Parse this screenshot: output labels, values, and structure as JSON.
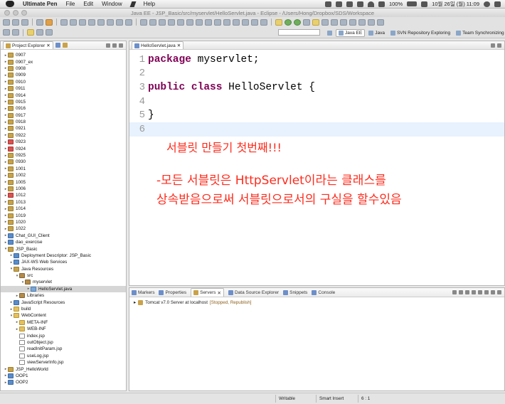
{
  "menubar": {
    "app_name": "Ultimate Pen",
    "menus": [
      "File",
      "Edit",
      "Window",
      "Help"
    ],
    "battery": "100%",
    "clock": "10월 26일 (월) 11:09"
  },
  "window": {
    "title": "Java EE - JSP_Basic/src/myservlet/HelloServlet.java - Eclipse - /Users/Hong/Dropbox/SDS/Workspace"
  },
  "perspectives": [
    {
      "label": "Java EE",
      "active": true
    },
    {
      "label": "Java",
      "active": false
    },
    {
      "label": "SVN Repository Exploring",
      "active": false
    },
    {
      "label": "Team Synchronizing",
      "active": false
    }
  ],
  "explorer": {
    "tab_label": "Project Explorer",
    "tree": [
      {
        "label": "0907",
        "depth": 0,
        "icon": "project-folder-icon",
        "expand": "collapsed"
      },
      {
        "label": "0907_ex",
        "depth": 0,
        "icon": "project-folder-icon",
        "expand": "collapsed"
      },
      {
        "label": "0908",
        "depth": 0,
        "icon": "project-folder-icon",
        "expand": "collapsed"
      },
      {
        "label": "0909",
        "depth": 0,
        "icon": "project-folder-icon",
        "expand": "collapsed"
      },
      {
        "label": "0910",
        "depth": 0,
        "icon": "project-folder-icon",
        "expand": "collapsed"
      },
      {
        "label": "0911",
        "depth": 0,
        "icon": "project-folder-icon",
        "expand": "collapsed"
      },
      {
        "label": "0914",
        "depth": 0,
        "icon": "project-folder-icon",
        "expand": "collapsed"
      },
      {
        "label": "0915",
        "depth": 0,
        "icon": "project-folder-icon",
        "expand": "collapsed"
      },
      {
        "label": "0916",
        "depth": 0,
        "icon": "project-folder-icon",
        "expand": "collapsed"
      },
      {
        "label": "0917",
        "depth": 0,
        "icon": "project-folder-icon",
        "expand": "collapsed"
      },
      {
        "label": "0918",
        "depth": 0,
        "icon": "project-folder-icon",
        "expand": "collapsed"
      },
      {
        "label": "0921",
        "depth": 0,
        "icon": "project-folder-icon",
        "expand": "collapsed"
      },
      {
        "label": "0922",
        "depth": 0,
        "icon": "project-folder-icon",
        "expand": "collapsed"
      },
      {
        "label": "0923",
        "depth": 0,
        "icon": "project-error-icon",
        "expand": "collapsed"
      },
      {
        "label": "0924",
        "depth": 0,
        "icon": "project-error-icon",
        "expand": "collapsed"
      },
      {
        "label": "0925",
        "depth": 0,
        "icon": "project-folder-icon",
        "expand": "collapsed"
      },
      {
        "label": "0930",
        "depth": 0,
        "icon": "project-folder-icon",
        "expand": "collapsed"
      },
      {
        "label": "1001",
        "depth": 0,
        "icon": "project-folder-icon",
        "expand": "collapsed"
      },
      {
        "label": "1002",
        "depth": 0,
        "icon": "project-folder-icon",
        "expand": "collapsed"
      },
      {
        "label": "1005",
        "depth": 0,
        "icon": "project-folder-icon",
        "expand": "collapsed"
      },
      {
        "label": "1006",
        "depth": 0,
        "icon": "project-folder-icon",
        "expand": "collapsed"
      },
      {
        "label": "1012",
        "depth": 0,
        "icon": "project-error-icon",
        "expand": "collapsed"
      },
      {
        "label": "1013",
        "depth": 0,
        "icon": "project-folder-icon",
        "expand": "collapsed"
      },
      {
        "label": "1014",
        "depth": 0,
        "icon": "project-folder-icon",
        "expand": "collapsed"
      },
      {
        "label": "1019",
        "depth": 0,
        "icon": "project-folder-icon",
        "expand": "collapsed"
      },
      {
        "label": "1020",
        "depth": 0,
        "icon": "project-folder-icon",
        "expand": "collapsed"
      },
      {
        "label": "1022",
        "depth": 0,
        "icon": "project-folder-icon",
        "expand": "collapsed"
      },
      {
        "label": "Chat_GUI_Client",
        "depth": 0,
        "icon": "java-project-icon",
        "expand": "collapsed"
      },
      {
        "label": "dao_exercise",
        "depth": 0,
        "icon": "java-project-icon",
        "expand": "collapsed"
      },
      {
        "label": "JSP_Basic",
        "depth": 0,
        "icon": "project-folder-icon",
        "expand": "expanded"
      },
      {
        "label": "Deployment Descriptor: JSP_Basic",
        "depth": 1,
        "icon": "descriptor-icon",
        "expand": "collapsed"
      },
      {
        "label": "JAX-WS Web Services",
        "depth": 1,
        "icon": "webservice-icon",
        "expand": "collapsed"
      },
      {
        "label": "Java Resources",
        "depth": 1,
        "icon": "resources-icon",
        "expand": "expanded"
      },
      {
        "label": "src",
        "depth": 2,
        "icon": "source-folder-icon",
        "expand": "expanded"
      },
      {
        "label": "myservlet",
        "depth": 3,
        "icon": "package-icon",
        "expand": "expanded"
      },
      {
        "label": "HelloServlet.java",
        "depth": 4,
        "icon": "java-file-icon",
        "expand": "collapsed",
        "selected": true
      },
      {
        "label": "Libraries",
        "depth": 2,
        "icon": "library-icon",
        "expand": "collapsed"
      },
      {
        "label": "JavaScript Resources",
        "depth": 1,
        "icon": "js-resources-icon",
        "expand": "collapsed"
      },
      {
        "label": "build",
        "depth": 1,
        "icon": "folder-icon",
        "expand": "collapsed"
      },
      {
        "label": "WebContent",
        "depth": 1,
        "icon": "folder-icon",
        "expand": "expanded"
      },
      {
        "label": "META-INF",
        "depth": 2,
        "icon": "folder-icon",
        "expand": "collapsed"
      },
      {
        "label": "WEB-INF",
        "depth": 2,
        "icon": "folder-icon",
        "expand": "collapsed"
      },
      {
        "label": "index.jsp",
        "depth": 2,
        "icon": "file-icon",
        "expand": "none"
      },
      {
        "label": "outObject.jsp",
        "depth": 2,
        "icon": "file-icon",
        "expand": "none"
      },
      {
        "label": "readInitParam.jsp",
        "depth": 2,
        "icon": "file-icon",
        "expand": "none"
      },
      {
        "label": "useLog.jsp",
        "depth": 2,
        "icon": "file-icon",
        "expand": "none"
      },
      {
        "label": "viewServerInfo.jsp",
        "depth": 2,
        "icon": "file-icon",
        "expand": "none"
      },
      {
        "label": "JSP_HelloWorld",
        "depth": 0,
        "icon": "project-folder-icon",
        "expand": "collapsed"
      },
      {
        "label": "OOP1",
        "depth": 0,
        "icon": "java-project-icon",
        "expand": "collapsed"
      },
      {
        "label": "OOP2",
        "depth": 0,
        "icon": "java-project-icon",
        "expand": "collapsed"
      }
    ]
  },
  "editor": {
    "tab_label": "HelloServlet.java",
    "lines": [
      {
        "num": "1",
        "keyword": "package",
        "rest": " myservlet;"
      },
      {
        "num": "2",
        "keyword": "",
        "rest": ""
      },
      {
        "num": "3",
        "keyword": "public class",
        "rest": " HelloServlet {"
      },
      {
        "num": "4",
        "keyword": "",
        "rest": ""
      },
      {
        "num": "5",
        "keyword": "",
        "rest": "}"
      },
      {
        "num": "6",
        "keyword": "",
        "rest": ""
      }
    ]
  },
  "annotations": {
    "note1": "서블릿 만들기 첫번째!!!",
    "note2_line1": "-모든 서블릿은 HttpServlet이라는 클래스를",
    "note2_line2": "상속받음으로써 서블릿으로서의 구실을 할수있음",
    "color": "#ff2b1c"
  },
  "bottom_panel": {
    "tabs": [
      {
        "label": "Markers",
        "active": false
      },
      {
        "label": "Properties",
        "active": false
      },
      {
        "label": "Servers",
        "active": true
      },
      {
        "label": "Data Source Explorer",
        "active": false
      },
      {
        "label": "Snippets",
        "active": false
      },
      {
        "label": "Console",
        "active": false
      }
    ],
    "server_name": "Tomcat v7.0 Server at localhost",
    "server_status": "[Stopped, Republish]"
  },
  "statusbar": {
    "mode": "Writable",
    "insert": "Smart Insert",
    "position": "6 : 1"
  }
}
